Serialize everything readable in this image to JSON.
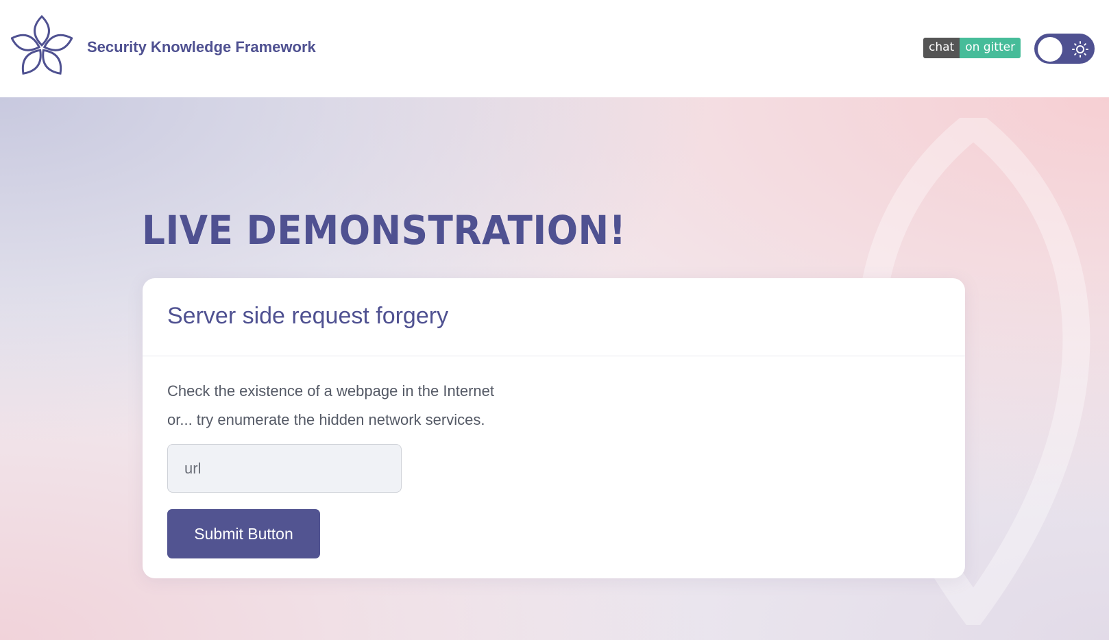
{
  "header": {
    "brand": "Security Knowledge Framework",
    "logo_icon": "flower-logo-icon",
    "gitter_left": "chat",
    "gitter_right": "on gitter",
    "theme_toggle_icon": "sun-icon"
  },
  "main": {
    "title": "LIVE DEMONSTRATION!",
    "card": {
      "title": "Server side request forgery",
      "line1": "Check the existence of a webpage in the Internet",
      "line2": "or... try enumerate the hidden network services.",
      "url_placeholder": "url",
      "submit_label": "Submit Button"
    }
  },
  "colors": {
    "brand": "#4f5191",
    "button": "#525491",
    "gitter_grey": "#555555",
    "gitter_green": "#46bc99"
  }
}
